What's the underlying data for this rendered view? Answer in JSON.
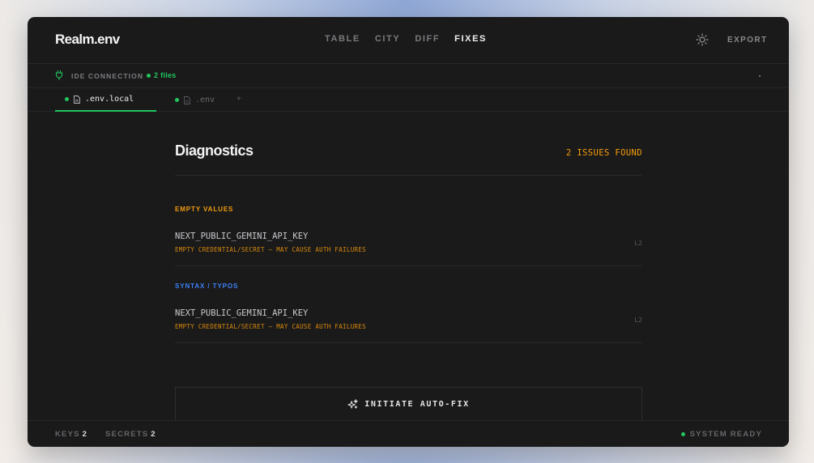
{
  "app": {
    "brand": "Realm.env"
  },
  "nav": {
    "items": [
      {
        "label": "TABLE",
        "active": false
      },
      {
        "label": "CITY",
        "active": false
      },
      {
        "label": "DIFF",
        "active": false
      },
      {
        "label": "FIXES",
        "active": true
      }
    ],
    "theme_icon": "sun-icon",
    "export_label": "EXPORT"
  },
  "ide": {
    "label": "IDE CONNECTION",
    "files": "2 files",
    "icon": "plug-icon"
  },
  "tabs": {
    "items": [
      {
        "label": ".env.local",
        "active": true
      },
      {
        "label": ".env",
        "active": false
      }
    ],
    "add_label": "+"
  },
  "diagnostics": {
    "title": "Diagnostics",
    "issues_found": "2 ISSUES FOUND",
    "sections": [
      {
        "label": "EMPTY VALUES",
        "issues": [
          {
            "key": "NEXT_PUBLIC_GEMINI_API_KEY",
            "message": "EMPTY CREDENTIAL/SECRET — MAY CAUSE AUTH FAILURES",
            "line": "L2"
          }
        ]
      },
      {
        "label": "SYNTAX / TYPOS",
        "issues": [
          {
            "key": "NEXT_PUBLIC_GEMINI_API_KEY",
            "message": "EMPTY CREDENTIAL/SECRET — MAY CAUSE AUTH FAILURES",
            "line": "L2"
          }
        ]
      }
    ],
    "autofix_label": "INITIATE AUTO-FIX"
  },
  "footer": {
    "keys_label": "KEYS",
    "keys_value": "2",
    "secrets_label": "SECRETS",
    "secrets_value": "2",
    "status": "SYSTEM READY"
  },
  "colors": {
    "accent_green": "#22c55e",
    "warning_orange": "#f59e0b",
    "syntax_blue": "#3b82f6",
    "background": "#1a1a1b"
  }
}
